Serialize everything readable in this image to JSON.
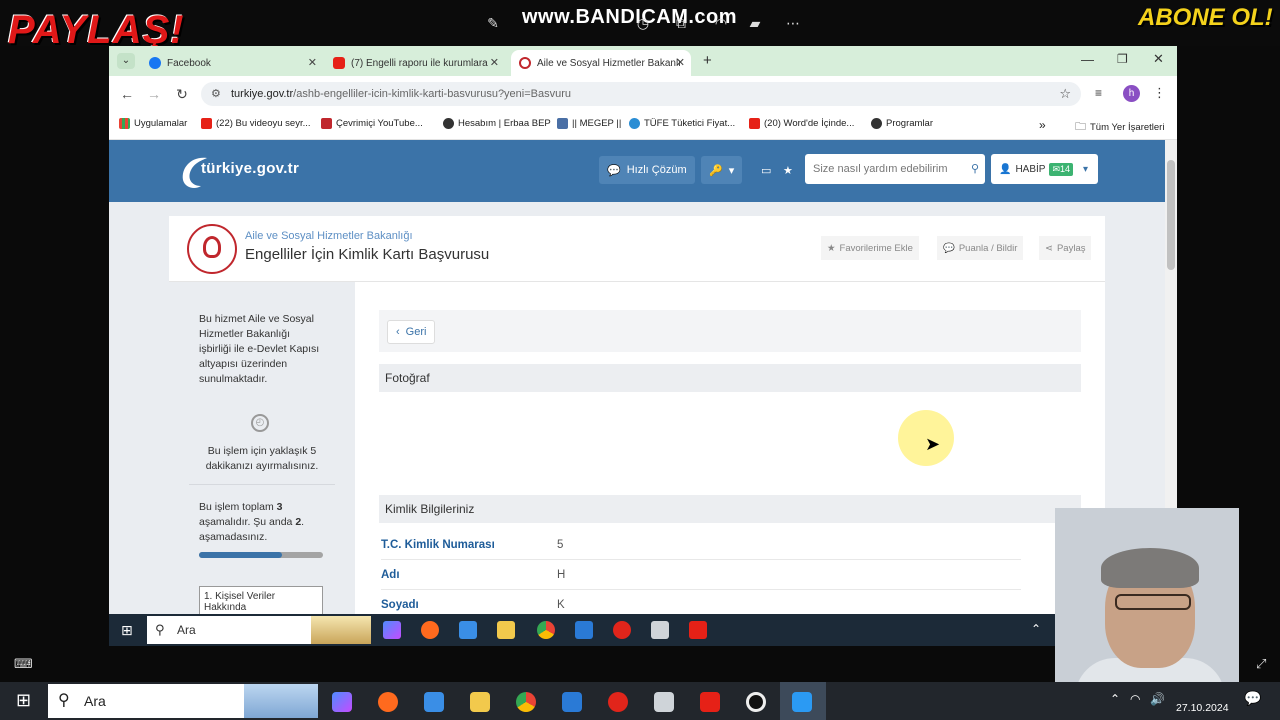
{
  "overlay": {
    "left_banner": "PAYLAŞ!",
    "center_watermark": "www.BANDICAM.com",
    "right_banner": "ABONE OL!"
  },
  "browser": {
    "tabs": [
      {
        "label": "Facebook",
        "icon": "facebook-icon",
        "color": "#1877f2"
      },
      {
        "label": "(7) Engelli raporu ile kurumlara",
        "icon": "youtube-icon",
        "color": "#e62117"
      },
      {
        "label": "Aile ve Sosyal Hizmetler Bakanlı",
        "icon": "edevlet-icon",
        "color": "#c0272d",
        "active": true
      }
    ],
    "new_tab": "+",
    "url_host": "turkiye.gov.tr",
    "url_path": "/ashb-engelliler-icin-kimlik-karti-basvurusu?yeni=Basvuru",
    "profile_initial": "h",
    "bookmarks": [
      {
        "label": "Uygulamalar",
        "color": "#ea4335"
      },
      {
        "label": "(22) Bu videoyu seyr...",
        "color": "#e62117"
      },
      {
        "label": "Çevrimiçi YouTube...",
        "color": "#c0272d"
      },
      {
        "label": "Hesabım | Erbaa BEP",
        "color": "#333333"
      },
      {
        "label": "|| MEGEP ||",
        "color": "#4a6fa5"
      },
      {
        "label": "TÜFE Tüketici Fiyat...",
        "color": "#2a8dd4"
      },
      {
        "label": "(20) Word'de İçinde...",
        "color": "#e62117"
      },
      {
        "label": "Programlar",
        "color": "#333333"
      }
    ],
    "bookmarks_more": "»",
    "all_bookmarks": "Tüm Yer İşaretleri"
  },
  "site": {
    "logo": "türkiye.gov.tr",
    "quick_solution": "Hızlı Çözüm",
    "search_placeholder": "Size nasıl yardım edebilirim",
    "user_name": "HABİP",
    "mail_count": "14",
    "brand_color": "#3b73a8"
  },
  "service": {
    "ministry": "Aile ve Sosyal Hizmetler Bakanlığı",
    "title": "Engelliler İçin Kimlik Kartı Başvurusu",
    "favorite": "Favorilerime Ekle",
    "rate": "Puanla / Bildir",
    "share": "Paylaş"
  },
  "sidebar": {
    "provider_note": "Bu hizmet Aile ve Sosyal Hizmetler Bakanlığı işbirliği ile e-Devlet Kapısı altyapısı üzerinden sunulmaktadır.",
    "duration_note": "Bu işlem için yaklaşık 5 dakikanızı ayırmalısınız.",
    "steps_prefix": "Bu işlem toplam ",
    "steps_total": "3",
    "steps_middle": " aşamalıdır. Şu anda ",
    "steps_current": "2",
    "steps_suffix": ". aşamadasınız.",
    "progress_fraction": 0.67,
    "step_1": "1. Kişisel Veriler Hakkında"
  },
  "content": {
    "back": "Geri",
    "photo_section": "Fotoğraf",
    "identity_section": "Kimlik Bilgileriniz",
    "rows": [
      {
        "label": "T.C. Kimlik Numarası",
        "value": "5"
      },
      {
        "label": "Adı",
        "value": "H"
      },
      {
        "label": "Soyadı",
        "value": "K"
      }
    ]
  },
  "inner_taskbar": {
    "search": "Ara"
  },
  "outer_taskbar": {
    "search": "Ara",
    "date": "27.10.2024"
  }
}
